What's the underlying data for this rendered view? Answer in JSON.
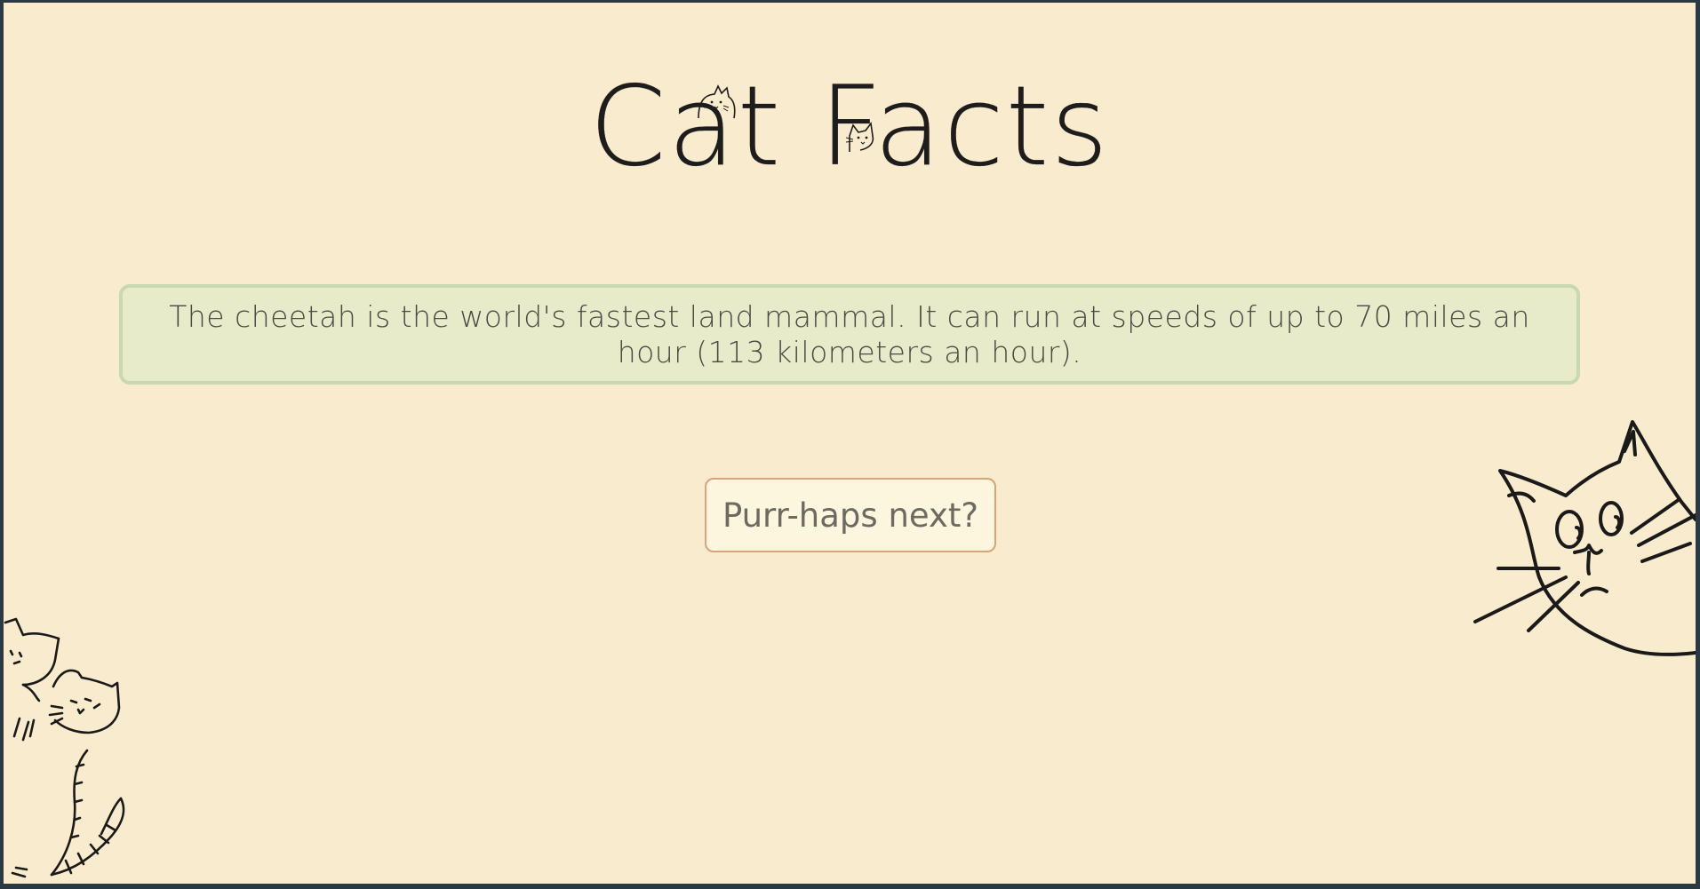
{
  "header": {
    "title": "Cat Facts"
  },
  "fact": {
    "text": "The cheetah is the world's fastest land mammal. It can run at speeds of up to 70 miles an hour (113 kilometers an hour)."
  },
  "actions": {
    "next_label": "Purr-haps next?"
  },
  "decorations": {
    "title_icons": [
      "cat-peek-icon",
      "cat-peek-icon"
    ],
    "corner_art": [
      "cat-face-illustration",
      "two-cats-illustration"
    ]
  },
  "colors": {
    "background": "#f9ecce",
    "fact_box": "#e7ebca",
    "fact_border": "#c8d8b0",
    "button_bg": "#fdf6df",
    "button_border": "#d9a27a",
    "frame": "#2b3a42"
  }
}
